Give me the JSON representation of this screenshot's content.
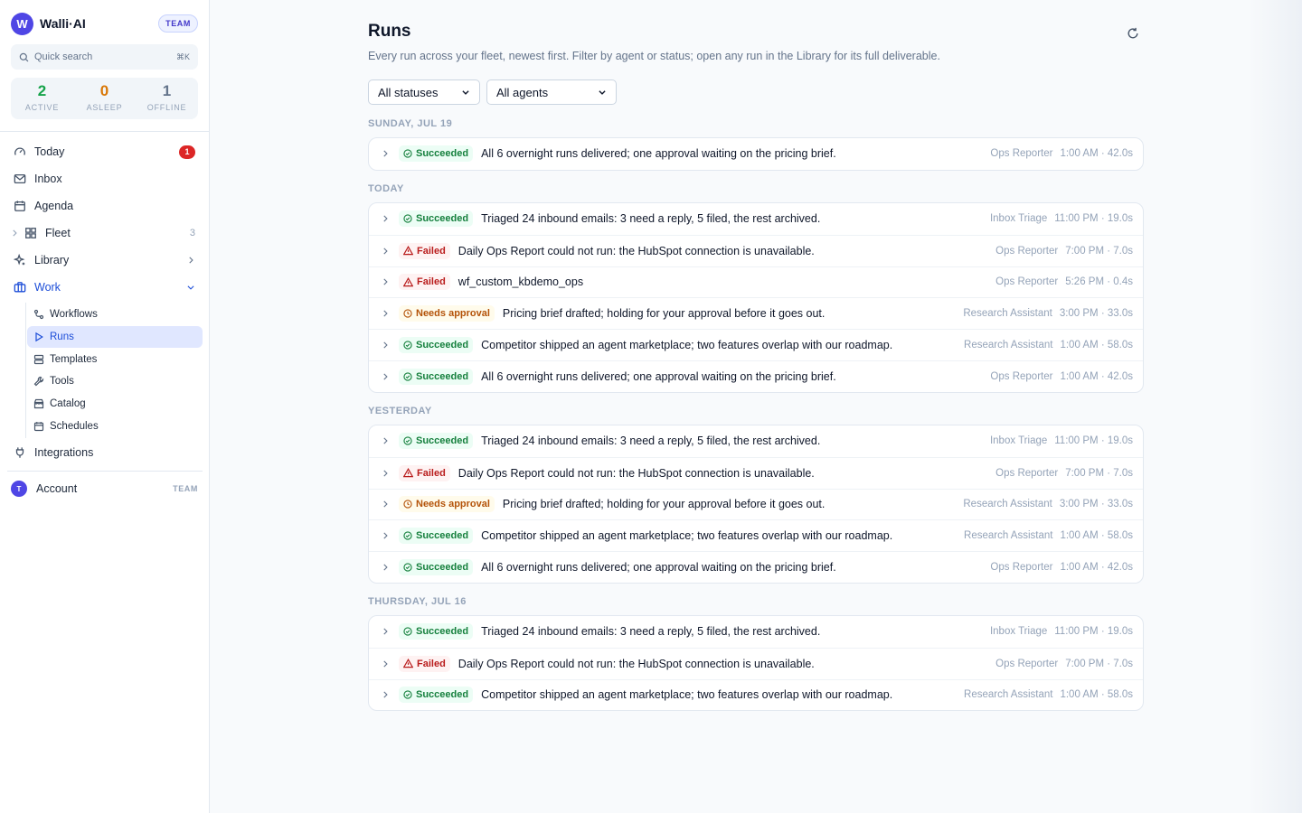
{
  "brand": {
    "logo_letter": "W",
    "name": "Walli·AI",
    "plan_badge": "TEAM"
  },
  "search": {
    "placeholder": "Quick search",
    "shortcut": "⌘K"
  },
  "fleet_stats": [
    {
      "value": "2",
      "label": "ACTIVE",
      "color": "#16a34a"
    },
    {
      "value": "0",
      "label": "ASLEEP",
      "color": "#d97706"
    },
    {
      "value": "1",
      "label": "OFFLINE",
      "color": "#64748b"
    }
  ],
  "nav": {
    "today": {
      "label": "Today",
      "badge": "1",
      "icon": "gauge-icon"
    },
    "inbox": {
      "label": "Inbox",
      "icon": "mail-icon"
    },
    "agenda": {
      "label": "Agenda",
      "icon": "calendar-icon"
    },
    "fleet": {
      "label": "Fleet",
      "count": "3",
      "icon": "grid-icon"
    },
    "library": {
      "label": "Library",
      "icon": "sparkle-icon"
    },
    "work": {
      "label": "Work",
      "icon": "briefcase-icon",
      "expanded": true,
      "children": [
        {
          "label": "Workflows",
          "icon": "workflow-icon"
        },
        {
          "label": "Runs",
          "icon": "play-icon",
          "selected": true
        },
        {
          "label": "Templates",
          "icon": "template-icon"
        },
        {
          "label": "Tools",
          "icon": "wrench-icon"
        },
        {
          "label": "Catalog",
          "icon": "store-icon"
        },
        {
          "label": "Schedules",
          "icon": "calendar-icon"
        }
      ]
    },
    "integrations": {
      "label": "Integrations",
      "icon": "plug-icon"
    }
  },
  "account": {
    "avatar_letter": "T",
    "label": "Account",
    "tag": "TEAM"
  },
  "page": {
    "title": "Runs",
    "subtitle": "Every run across your fleet, newest first. Filter by agent or status; open any run in the Library for its full deliverable."
  },
  "filters": {
    "status": {
      "selected": "All statuses"
    },
    "agent": {
      "selected": "All agents"
    }
  },
  "colors": {
    "accent": "#4f46e5",
    "succeeded": "#15803d",
    "failed": "#b91c1c",
    "needs_approval": "#b45309"
  },
  "groups": [
    {
      "label": "SUNDAY, JUL 19",
      "runs": [
        {
          "status": "Succeeded",
          "summary": "All 6 overnight runs delivered; one approval waiting on the pricing brief.",
          "agent": "Ops Reporter",
          "time": "1:00 AM · 42.0s"
        }
      ]
    },
    {
      "label": "TODAY",
      "runs": [
        {
          "status": "Succeeded",
          "summary": "Triaged 24 inbound emails: 3 need a reply, 5 filed, the rest archived.",
          "agent": "Inbox Triage",
          "time": "11:00 PM · 19.0s"
        },
        {
          "status": "Failed",
          "summary": "Daily Ops Report could not run: the HubSpot connection is unavailable.",
          "agent": "Ops Reporter",
          "time": "7:00 PM · 7.0s"
        },
        {
          "status": "Failed",
          "summary": "wf_custom_kbdemo_ops",
          "agent": "Ops Reporter",
          "time": "5:26 PM · 0.4s"
        },
        {
          "status": "Needs approval",
          "summary": "Pricing brief drafted; holding for your approval before it goes out.",
          "agent": "Research Assistant",
          "time": "3:00 PM · 33.0s"
        },
        {
          "status": "Succeeded",
          "summary": "Competitor shipped an agent marketplace; two features overlap with our roadmap.",
          "agent": "Research Assistant",
          "time": "1:00 AM · 58.0s"
        },
        {
          "status": "Succeeded",
          "summary": "All 6 overnight runs delivered; one approval waiting on the pricing brief.",
          "agent": "Ops Reporter",
          "time": "1:00 AM · 42.0s"
        }
      ]
    },
    {
      "label": "YESTERDAY",
      "runs": [
        {
          "status": "Succeeded",
          "summary": "Triaged 24 inbound emails: 3 need a reply, 5 filed, the rest archived.",
          "agent": "Inbox Triage",
          "time": "11:00 PM · 19.0s"
        },
        {
          "status": "Failed",
          "summary": "Daily Ops Report could not run: the HubSpot connection is unavailable.",
          "agent": "Ops Reporter",
          "time": "7:00 PM · 7.0s"
        },
        {
          "status": "Needs approval",
          "summary": "Pricing brief drafted; holding for your approval before it goes out.",
          "agent": "Research Assistant",
          "time": "3:00 PM · 33.0s"
        },
        {
          "status": "Succeeded",
          "summary": "Competitor shipped an agent marketplace; two features overlap with our roadmap.",
          "agent": "Research Assistant",
          "time": "1:00 AM · 58.0s"
        },
        {
          "status": "Succeeded",
          "summary": "All 6 overnight runs delivered; one approval waiting on the pricing brief.",
          "agent": "Ops Reporter",
          "time": "1:00 AM · 42.0s"
        }
      ]
    },
    {
      "label": "THURSDAY, JUL 16",
      "runs": [
        {
          "status": "Succeeded",
          "summary": "Triaged 24 inbound emails: 3 need a reply, 5 filed, the rest archived.",
          "agent": "Inbox Triage",
          "time": "11:00 PM · 19.0s"
        },
        {
          "status": "Failed",
          "summary": "Daily Ops Report could not run: the HubSpot connection is unavailable.",
          "agent": "Ops Reporter",
          "time": "7:00 PM · 7.0s"
        },
        {
          "status": "Succeeded",
          "summary": "Competitor shipped an agent marketplace; two features overlap with our roadmap.",
          "agent": "Research Assistant",
          "time": "1:00 AM · 58.0s"
        }
      ]
    }
  ]
}
